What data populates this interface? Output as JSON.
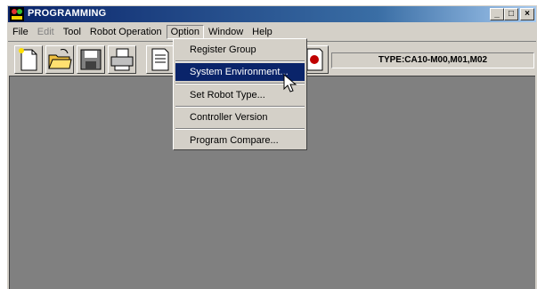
{
  "window": {
    "title": "PROGRAMMING",
    "minimize": "_",
    "maximize": "□",
    "close": "×"
  },
  "menubar": {
    "items": [
      {
        "label": "File"
      },
      {
        "label": "Edit"
      },
      {
        "label": "Tool"
      },
      {
        "label": "Robot Operation"
      },
      {
        "label": "Option"
      },
      {
        "label": "Window"
      },
      {
        "label": "Help"
      }
    ]
  },
  "toolbar": {
    "buttons": [
      {
        "icon": "new-file-icon"
      },
      {
        "icon": "open-folder-icon"
      },
      {
        "icon": "save-icon"
      },
      {
        "icon": "print-icon"
      },
      {
        "icon": "document-icon"
      },
      {
        "icon": "robot-icon"
      }
    ],
    "type_label": "TYPE:CA10-M00,M01,M02"
  },
  "option_menu": {
    "items": [
      {
        "label": "Register Group"
      },
      {
        "label": "System Environment..."
      },
      {
        "label": "Set Robot Type..."
      },
      {
        "label": "Controller Version"
      },
      {
        "label": "Program Compare..."
      }
    ],
    "highlighted": "System Environment..."
  },
  "colors": {
    "title_bar": "#0a246a",
    "highlight": "#0a246a",
    "workspace": "#808080",
    "chrome": "#d4d0c8"
  }
}
